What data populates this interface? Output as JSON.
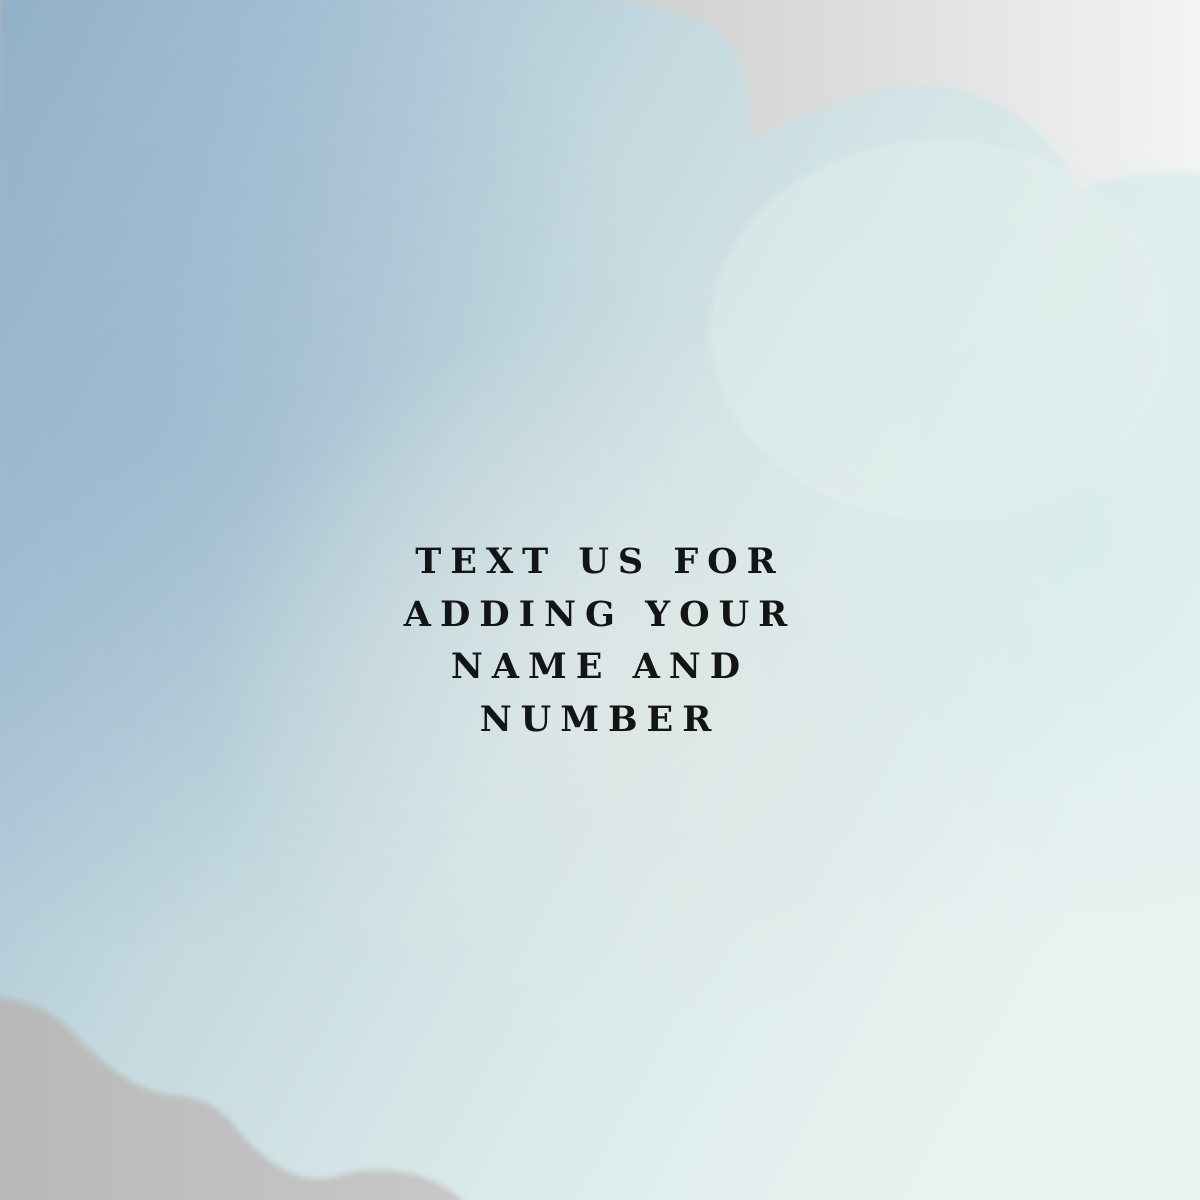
{
  "message": {
    "lines": [
      "TEXT US FOR",
      "ADDING YOUR",
      "NAME AND",
      "NUMBER"
    ]
  },
  "colors": {
    "backdrop_gray": "#c4c4c4",
    "backdrop_light": "#f6f6f6",
    "wash_blue": "#a2bdd3",
    "wash_mint": "#dcebea",
    "wash_pale": "#e6f0ee",
    "text": "#121416"
  }
}
